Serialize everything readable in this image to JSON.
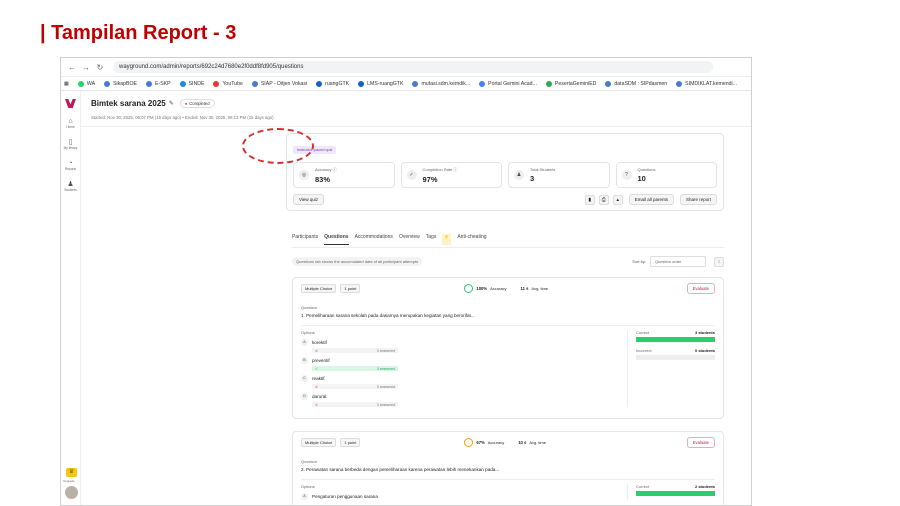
{
  "slide": {
    "title": "| Tampilan Report - 3"
  },
  "browser": {
    "url": "wayground.com/admin/reports/692c24d7680e2f0ddf8fd905/questions",
    "bookmarks": [
      {
        "label": "WA",
        "color": "#25d366"
      },
      {
        "label": "SikapBOE",
        "color": "#4a7bd0"
      },
      {
        "label": "E-SKP",
        "color": "#4a7bd0"
      },
      {
        "label": "SINDE",
        "color": "#1e88e5"
      },
      {
        "label": "YouTube",
        "color": "#e53935"
      },
      {
        "label": "SIAP - Ditjen Vokasi",
        "color": "#4a7bd0"
      },
      {
        "label": "ruangGTK",
        "color": "#1565c0"
      },
      {
        "label": "LMS-ruangGTK",
        "color": "#1565c0"
      },
      {
        "label": "mutasi.sdm.kemdik...",
        "color": "#4a7bd0"
      },
      {
        "label": "Portal Gemini Acad...",
        "color": "#4285f4"
      },
      {
        "label": "PesertaGeminiED",
        "color": "#34a853"
      },
      {
        "label": "dataSDM : SIPdasmen",
        "color": "#4a7bd0"
      },
      {
        "label": "SIMDIKLAT.kemendi...",
        "color": "#4a7bd0"
      }
    ]
  },
  "sidebar": {
    "items": [
      {
        "label": "Home",
        "icon": "home-icon",
        "glyph": "⌂"
      },
      {
        "label": "My library",
        "icon": "library-icon",
        "glyph": "▯"
      },
      {
        "label": "Reports",
        "icon": "reports-icon",
        "glyph": "◔"
      },
      {
        "label": "Students",
        "icon": "students-icon",
        "glyph": "♟"
      }
    ],
    "upgrade": "Upgrade"
  },
  "header": {
    "title": "Bimtek sarana 2025",
    "status": "Completed",
    "meta": "Started: Nov 30, 2025, 06:07 PM (15 days ago)  •  Ended: Nov 30, 2025, 06:13 PM (15 days ago)"
  },
  "summary": {
    "tag": "Instructor-paced quiz",
    "stats": [
      {
        "label": "Accuracy ⓘ",
        "value": "83%",
        "icon": "target-icon",
        "glyph": "◎"
      },
      {
        "label": "Completion Rate ⓘ",
        "value": "97%",
        "icon": "check-circle-icon",
        "glyph": "✓"
      },
      {
        "label": "Total Students",
        "value": "3",
        "icon": "users-icon",
        "glyph": "♟"
      },
      {
        "label": "Questions",
        "value": "10",
        "icon": "question-icon",
        "glyph": "?"
      }
    ],
    "view_quiz": "View quiz",
    "email_parents": "Email all parents",
    "share_report": "Share report"
  },
  "tabs": [
    {
      "label": "Participants",
      "active": false
    },
    {
      "label": "Questions",
      "active": true
    },
    {
      "label": "Accommodations",
      "active": false
    },
    {
      "label": "Overview",
      "active": false
    },
    {
      "label": "Tags",
      "active": false
    },
    {
      "label": "Anti-cheating",
      "active": false
    }
  ],
  "info": "Questions tab shows the accumulated data of all participant attempts",
  "sort": {
    "label": "Sort by:",
    "value": "Question order"
  },
  "questions": [
    {
      "type": "Multiple Choice",
      "points": "1 point",
      "accuracy": "100%",
      "accuracy_label": "Accuracy",
      "avg_time": "11 s",
      "avg_label": "Avg. time",
      "evaluate": "Evaluate",
      "question_label": "Question",
      "text": "1. Pemeliharaan sarana sekolah pada dasarnya merupakan kegiatan yang berorifat...",
      "options_label": "Options",
      "options": [
        {
          "letter": "A",
          "text": "korektif",
          "answered": "0 answered",
          "correct": false
        },
        {
          "letter": "B",
          "text": "preventif",
          "answered": "3 answered",
          "correct": true
        },
        {
          "letter": "C",
          "text": "reaktif",
          "answered": "0 answered",
          "correct": false
        },
        {
          "letter": "D",
          "text": "darurat",
          "answered": "0 answered",
          "correct": false
        }
      ],
      "correct_label": "Correct",
      "correct_count": "3 students",
      "incorrect_label": "Incorrect",
      "incorrect_count": "0 students"
    },
    {
      "type": "Multiple Choice",
      "points": "1 point",
      "accuracy": "67%",
      "accuracy_label": "Accuracy",
      "avg_time": "10 s",
      "avg_label": "Avg. time",
      "evaluate": "Evaluate",
      "question_label": "Question",
      "text": "2. Perawatan sarana berbeda dengan pemeliharaan karena perawatan lebih menekankan pada...",
      "options_label": "Options",
      "first_option": {
        "letter": "A",
        "text": "Pengaturan penggunaan sarana"
      },
      "correct_label": "Correct",
      "correct_count": "2 students"
    }
  ]
}
